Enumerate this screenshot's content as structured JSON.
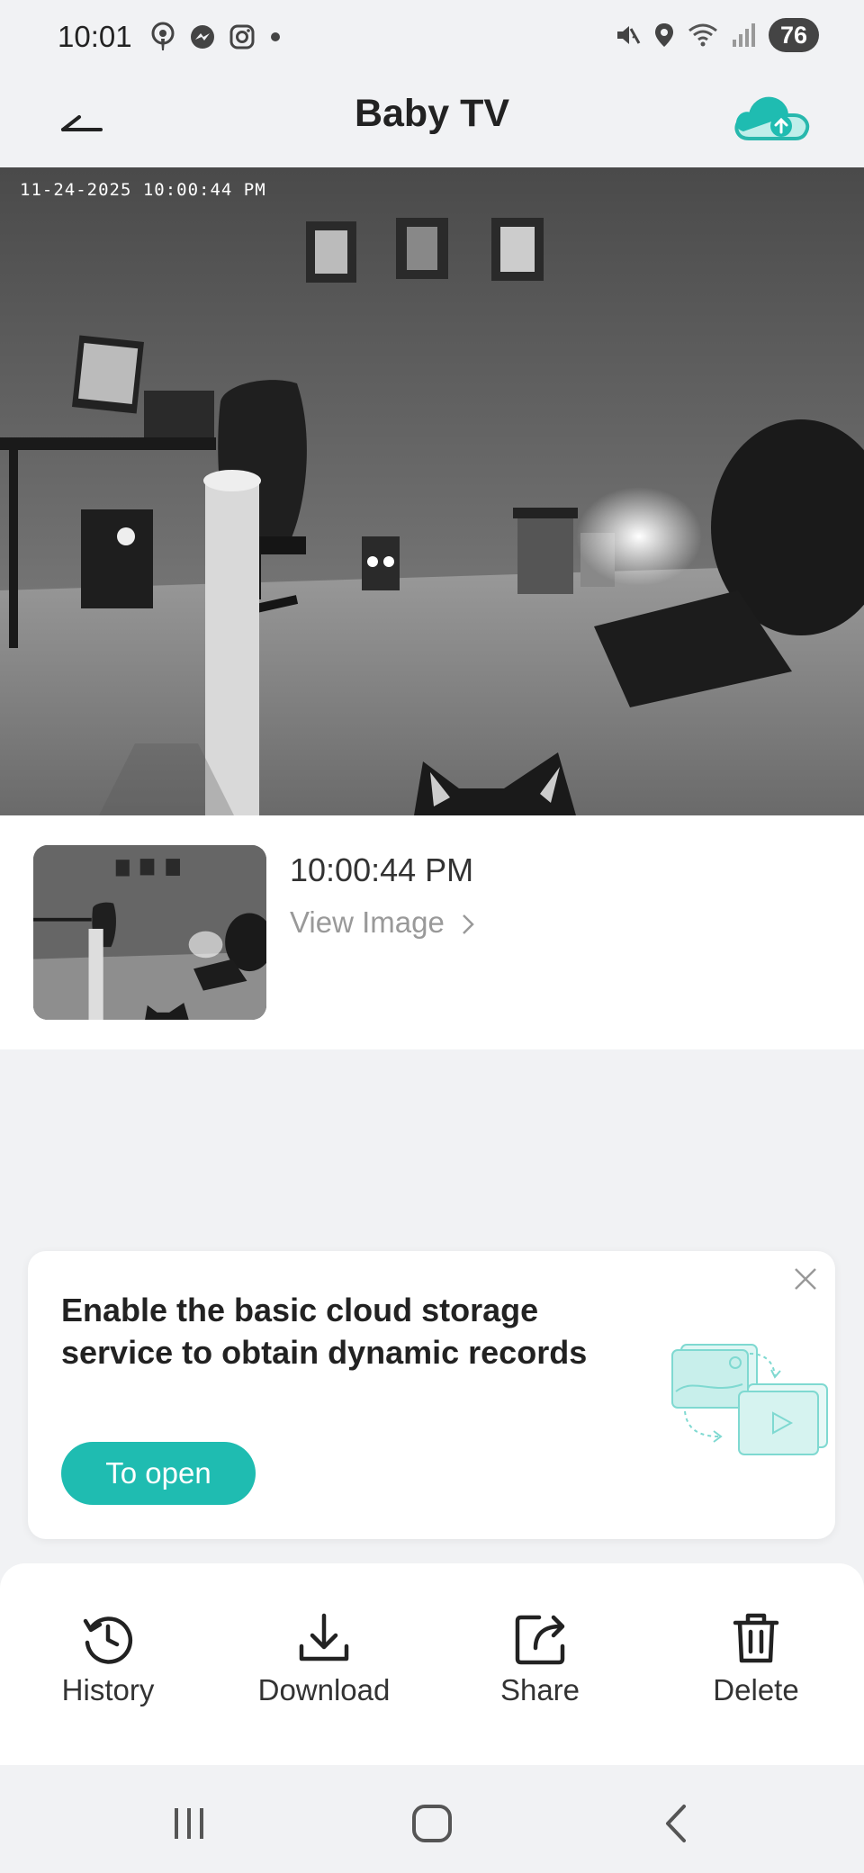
{
  "status_bar": {
    "time": "10:01",
    "battery": "76",
    "left_icons": [
      "podcast-icon",
      "messenger-icon",
      "instagram-icon",
      "dot-icon"
    ],
    "right_icons": [
      "mute-icon",
      "location-icon",
      "wifi-icon",
      "signal-icon"
    ]
  },
  "header": {
    "title": "Baby TV"
  },
  "camera": {
    "timestamp": "11-24-2025 10:00:44 PM"
  },
  "record": {
    "time": "10:00:44 PM",
    "view_label": "View Image"
  },
  "promo": {
    "text": "Enable the basic cloud storage service to obtain dynamic records",
    "button_label": "To open"
  },
  "toolbar": {
    "items": [
      {
        "label": "History",
        "icon": "history-icon"
      },
      {
        "label": "Download",
        "icon": "download-icon"
      },
      {
        "label": "Share",
        "icon": "share-icon"
      },
      {
        "label": "Delete",
        "icon": "trash-icon"
      }
    ]
  },
  "colors": {
    "accent": "#1fbcb1",
    "background": "#f1f2f4"
  }
}
